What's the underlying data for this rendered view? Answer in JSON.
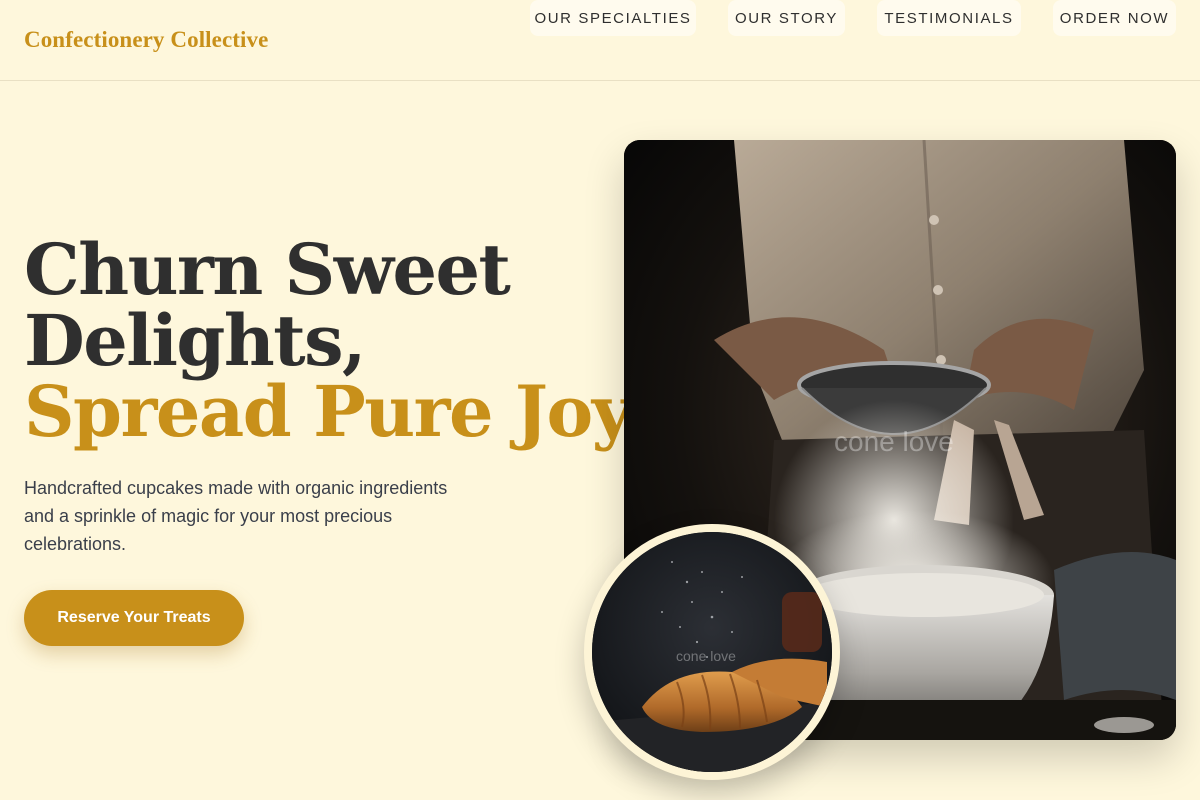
{
  "brand": {
    "name": "Confectionery Collective"
  },
  "nav": {
    "items": [
      {
        "label": "OUR SPECIALTIES"
      },
      {
        "label": "OUR STORY"
      },
      {
        "label": "TESTIMONIALS"
      },
      {
        "label": "ORDER NOW"
      }
    ]
  },
  "hero": {
    "headline_line1": "Churn Sweet",
    "headline_line2": "Delights,",
    "headline_accent": "Spread Pure Joy.",
    "subtext": "Handcrafted cupcakes made with organic ingredients and a sprinkle of magic for your most precious celebrations.",
    "cta_label": "Reserve Your Treats"
  },
  "images": {
    "main_photo_watermark": "cone love",
    "inset_photo_watermark": "cone love"
  },
  "colors": {
    "background": "#fef7dc",
    "accent": "#c8901a",
    "text": "#2f2f2f"
  }
}
